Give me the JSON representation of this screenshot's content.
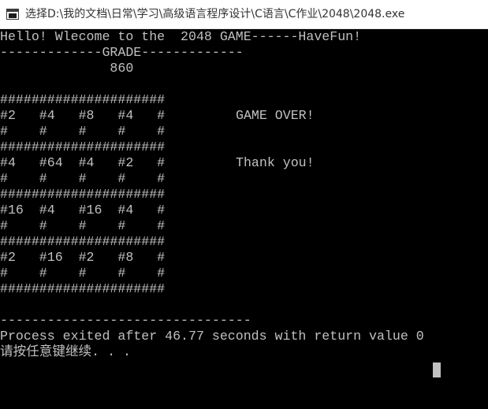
{
  "window": {
    "title": "选择D:\\我的文档\\日常\\学习\\高级语言程序设计\\C语言\\C作业\\2048\\2048.exe",
    "icon": "console-app-icon"
  },
  "console": {
    "greeting": "Hello! Wlecome to the  2048 GAME------HaveFun!",
    "grade_rule": "-------------GRADE-------------",
    "grade_value": "              860",
    "board": {
      "border": "#####################",
      "rows": [
        {
          "values": "#2   #4   #8   #4   #",
          "filler": "#    #    #    #    #"
        },
        {
          "values": "#4   #64  #4   #2   #",
          "filler": "#    #    #    #    #"
        },
        {
          "values": "#16  #4   #16  #4   #",
          "filler": "#    #    #    #    #"
        },
        {
          "values": "#2   #16  #2   #8   #",
          "filler": "#    #    #    #    #"
        }
      ]
    },
    "messages": {
      "game_over": "GAME OVER!",
      "thanks": "Thank you!"
    },
    "separator": "--------------------------------",
    "process_exit": "Process exited after 46.77 seconds with return value 0",
    "press_any_key": "请按任意键继续. . ."
  },
  "colors": {
    "console_background": "#000000",
    "console_text": "#c0c0c0",
    "titlebar_background": "#ffffff",
    "title_text": "#333333"
  }
}
